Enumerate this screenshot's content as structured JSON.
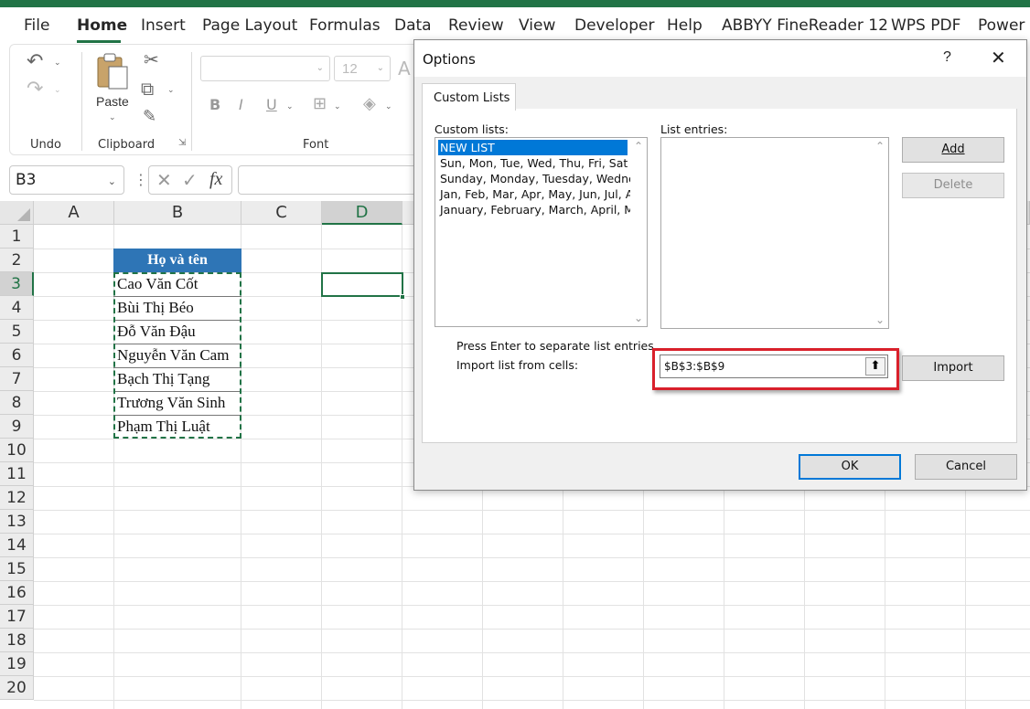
{
  "menu": {
    "tabs": [
      "File",
      "Home",
      "Insert",
      "Page Layout",
      "Formulas",
      "Data",
      "Review",
      "View",
      "Developer",
      "Help",
      "ABBYY FineReader 12",
      "WPS PDF",
      "Power P"
    ],
    "active": "Home"
  },
  "ribbon": {
    "undo_group": "Undo",
    "clipboard_group": "Clipboard",
    "font_group": "Font",
    "paste_label": "Paste",
    "font_size": "12",
    "bold": "B",
    "italic": "I",
    "underline": "U"
  },
  "formula_bar": {
    "name_box": "B3",
    "fx": "fx",
    "cancel": "✕",
    "enter": "✓"
  },
  "sheet": {
    "columns": [
      "A",
      "B",
      "C",
      "D"
    ],
    "rows": [
      "1",
      "2",
      "3",
      "4",
      "5",
      "6",
      "7",
      "8",
      "9",
      "10",
      "11",
      "12",
      "13",
      "14",
      "15",
      "16",
      "17",
      "18",
      "19",
      "20"
    ],
    "header_cell": "Họ và tên",
    "names": [
      "Cao Văn Cốt",
      "Bùi Thị Béo",
      "Đỗ Văn Đậu",
      "Nguyễn Văn Cam",
      "Bạch Thị Tạng",
      "Trương Văn Sinh",
      "Phạm Thị Luật"
    ]
  },
  "dialog": {
    "title": "Options",
    "help": "?",
    "close": "✕",
    "tab": "Custom Lists",
    "custom_lists_label": "Custom lists:",
    "list_entries_label": "List entries:",
    "custom_lists": [
      "NEW LIST",
      "Sun, Mon, Tue, Wed, Thu, Fri, Sat",
      "Sunday, Monday, Tuesday, Wednes",
      "Jan, Feb, Mar, Apr, May, Jun, Jul, Au",
      "January, February, March, April, Ma"
    ],
    "selected_list": "NEW LIST",
    "add_button": "Add",
    "delete_button": "Delete",
    "hint": "Press Enter to separate list entries.",
    "import_label": "Import list from cells:",
    "import_range": "$B$3:$B$9",
    "import_button": "Import",
    "ok_button": "OK",
    "cancel_button": "Cancel"
  },
  "colors": {
    "excel_green": "#217346",
    "header_fill": "#2e75b6",
    "selection_blue": "#0078d7",
    "highlight_red": "#d9202b"
  }
}
